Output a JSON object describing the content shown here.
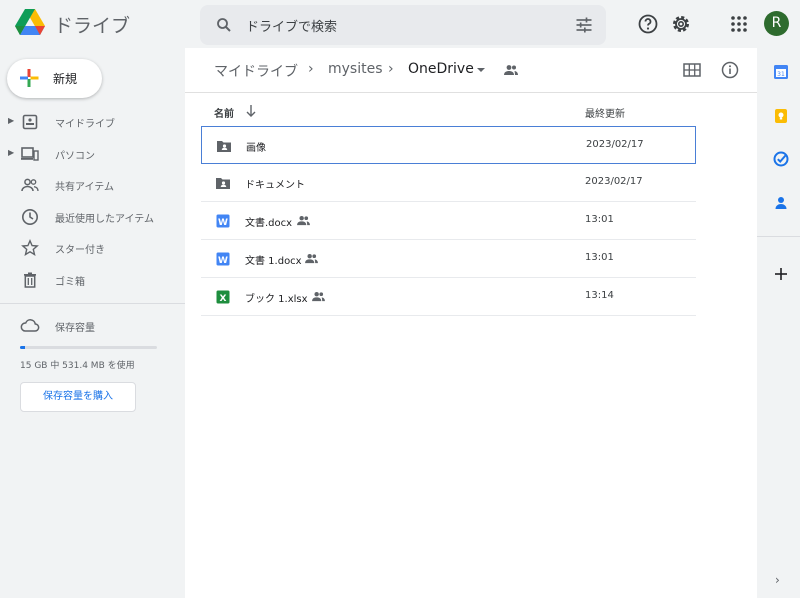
{
  "header": {
    "app_title": "ドライブ",
    "search_placeholder": "ドライブで検索",
    "avatar_initial": "R"
  },
  "sidebar": {
    "new_label": "新規",
    "items": [
      {
        "label": "マイドライブ",
        "icon": "my-drive-icon",
        "expandable": true
      },
      {
        "label": "パソコン",
        "icon": "computers-icon",
        "expandable": true
      },
      {
        "label": "共有アイテム",
        "icon": "shared-people-icon",
        "expandable": false
      },
      {
        "label": "最近使用したアイテム",
        "icon": "clock-icon",
        "expandable": false
      },
      {
        "label": "スター付き",
        "icon": "star-icon",
        "expandable": false
      },
      {
        "label": "ゴミ箱",
        "icon": "trash-icon",
        "expandable": false
      }
    ],
    "storage": {
      "title": "保存容量",
      "usage_text": "15 GB 中 531.4 MB を使用",
      "used_fraction": 0.035,
      "buy_label": "保存容量を購入"
    }
  },
  "breadcrumb": {
    "items": [
      "マイドライブ",
      "mysites",
      "OneDrive"
    ]
  },
  "file_list": {
    "columns": {
      "name": "名前",
      "modified": "最終更新"
    },
    "rows": [
      {
        "name": "画像",
        "type": "shared-folder",
        "shared": false,
        "modified": "2023/02/17",
        "selected": true
      },
      {
        "name": "ドキュメント",
        "type": "shared-folder",
        "shared": false,
        "modified": "2023/02/17",
        "selected": false
      },
      {
        "name": "文書.docx",
        "type": "word",
        "shared": true,
        "modified": "13:01",
        "selected": false
      },
      {
        "name": "文書 1.docx",
        "type": "word",
        "shared": true,
        "modified": "13:01",
        "selected": false
      },
      {
        "name": "ブック 1.xlsx",
        "type": "excel",
        "shared": true,
        "modified": "13:14",
        "selected": false
      }
    ]
  },
  "colors": {
    "accent": "#1a73e8",
    "word": "#4285f4",
    "excel": "#1e8e3e",
    "avatar": "#2e6b2e",
    "selection_border": "#4a7fd6"
  },
  "rail": {
    "icons": [
      "calendar-icon",
      "keep-icon",
      "tasks-icon",
      "contacts-icon",
      "add-icon"
    ]
  }
}
